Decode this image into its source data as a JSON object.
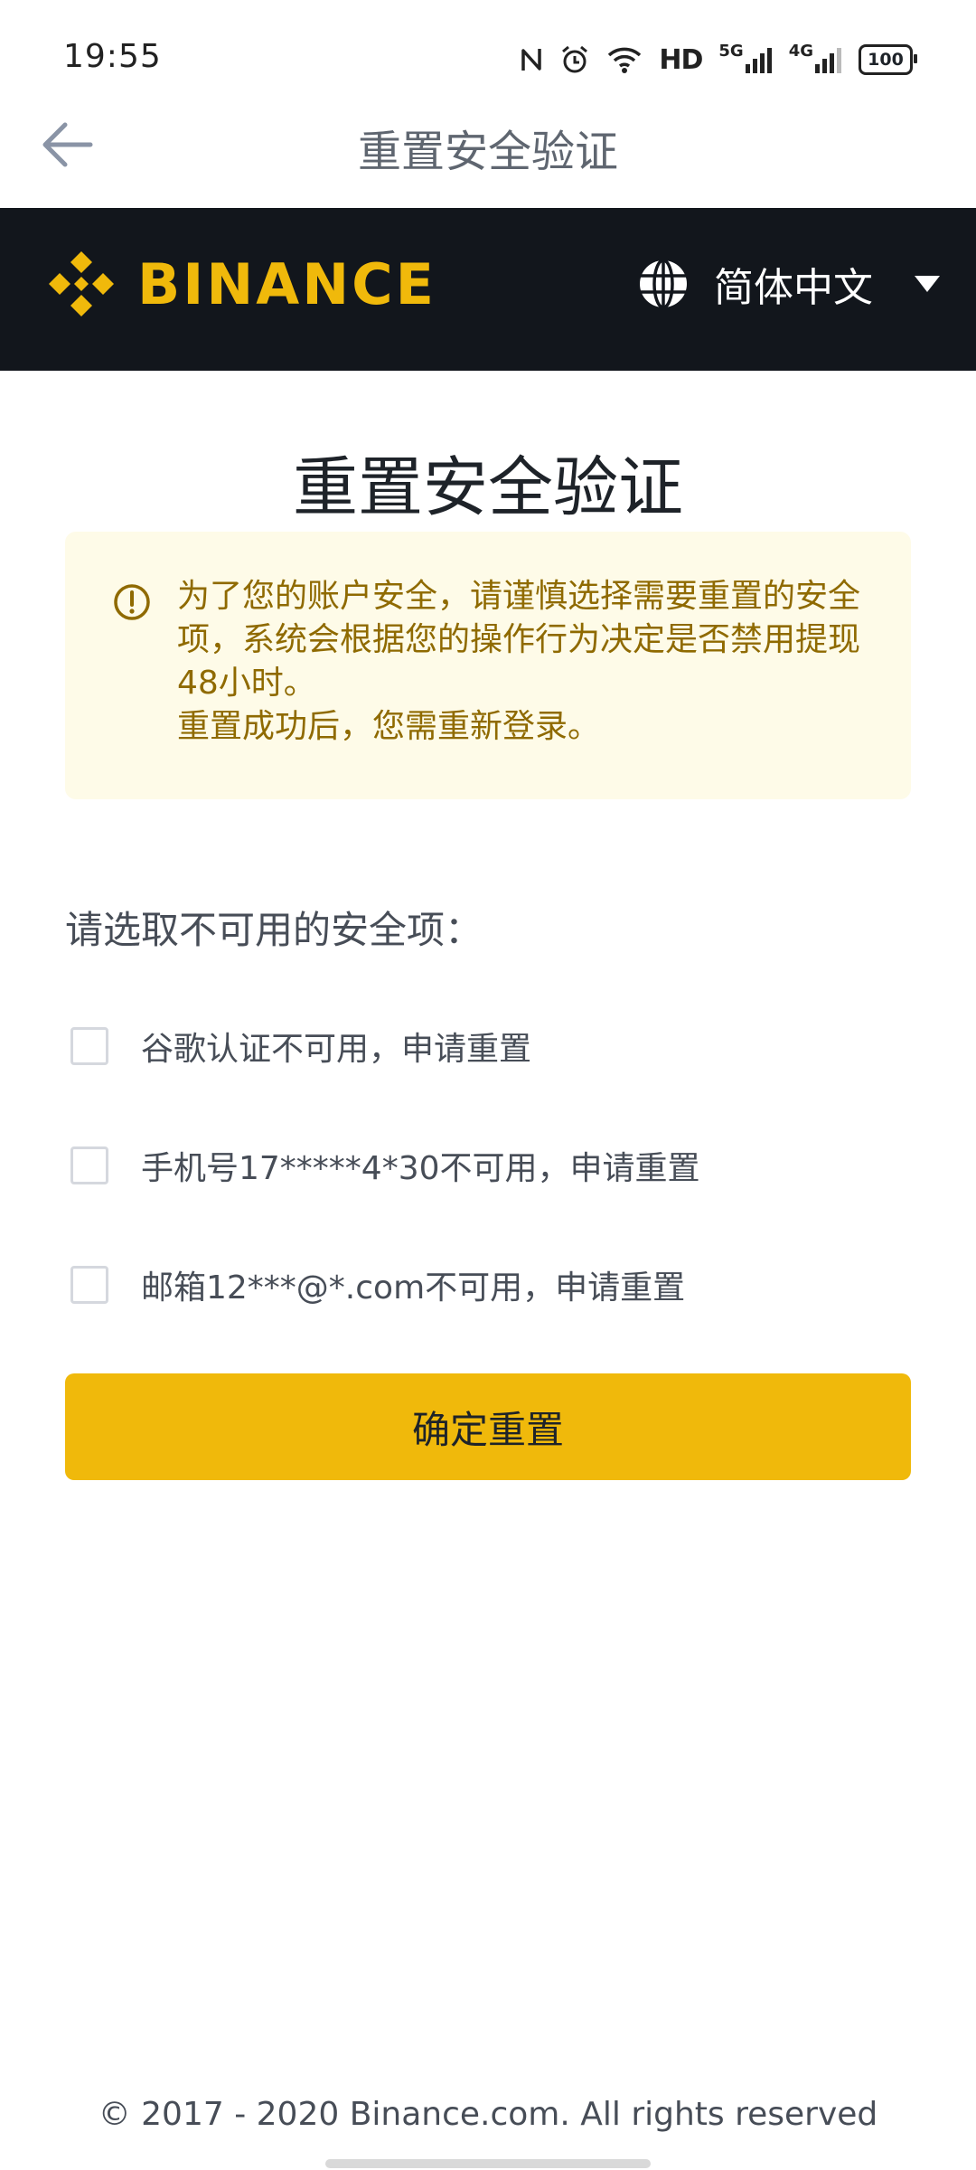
{
  "status_bar": {
    "time": "19:55",
    "icons": [
      "nfc-icon",
      "alarm-icon",
      "wifi-icon",
      "hd-icon",
      "signal-5g-icon",
      "signal-4g-icon",
      "battery-icon"
    ],
    "hd_label": "HD",
    "net1": "5G",
    "net2": "4G",
    "battery": "100"
  },
  "header": {
    "title": "重置安全验证",
    "back_icon": "arrow-left-icon"
  },
  "brand": {
    "name": "BINANCE",
    "color": "#f0b90b",
    "bar_color": "#12161c",
    "language": "简体中文",
    "language_icon": "globe-icon"
  },
  "main": {
    "title": "重置安全验证",
    "notice": {
      "icon": "warning-circle-icon",
      "line1": "为了您的账户安全，请谨慎选择需要重置的安全项，系统会根据您的操作行为决定是否禁用提现48小时。",
      "line2": "重置成功后，您需重新登录。",
      "text_color": "#8f6a00",
      "bg_color": "#fefbe8"
    },
    "section_label": "请选取不可用的安全项：",
    "options": [
      {
        "label": "谷歌认证不可用，申请重置",
        "checked": false
      },
      {
        "label": "手机号17*****4*30不可用，申请重置",
        "checked": false
      },
      {
        "label": "邮箱12***@*.com不可用，申请重置",
        "checked": false
      }
    ],
    "confirm_label": "确定重置",
    "accent": "#f0b90b"
  },
  "footer": {
    "copyright": "© 2017 - 2020 Binance.com. All rights reserved"
  }
}
